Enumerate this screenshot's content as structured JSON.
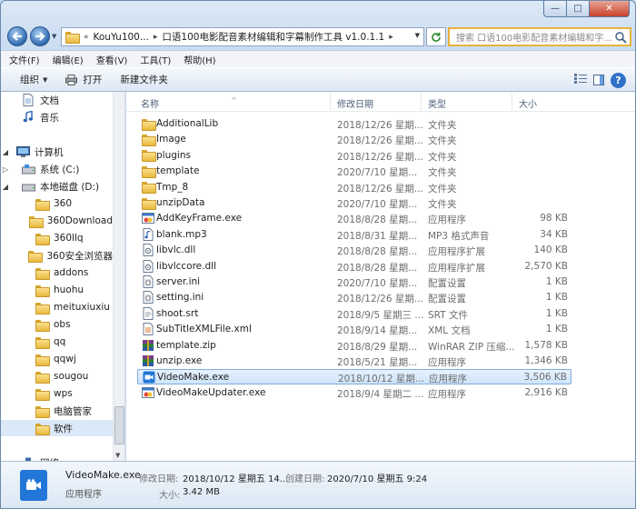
{
  "window": {
    "caption_minimize": "—",
    "caption_maximize": "□",
    "caption_close": "✕"
  },
  "address_bar": {
    "crumbs": [
      "«",
      "KouYu100...",
      "口语100电影配音素材编辑和字幕制作工具 v1.0.1.1"
    ],
    "search_placeholder": "搜索 口语100电影配音素材编辑和字..."
  },
  "menu": [
    "文件(F)",
    "编辑(E)",
    "查看(V)",
    "工具(T)",
    "帮助(H)"
  ],
  "toolbar": {
    "organize": "组织",
    "print": "打开",
    "new_folder": "新建文件夹"
  },
  "nav_pane": {
    "items": [
      {
        "label": "文档",
        "icon": "document-icon"
      },
      {
        "label": "音乐",
        "icon": "music-icon"
      },
      {
        "label": "计算机",
        "icon": "computer-icon"
      },
      {
        "label": "系统 (C:)",
        "icon": "drive-icon"
      },
      {
        "label": "本地磁盘 (D:)",
        "icon": "drive-icon"
      },
      {
        "label": "360",
        "icon": "folder-icon"
      },
      {
        "label": "360Download",
        "icon": "folder-icon"
      },
      {
        "label": "360llq",
        "icon": "folder-icon"
      },
      {
        "label": "360安全浏览器",
        "icon": "folder-icon"
      },
      {
        "label": "addons",
        "icon": "folder-icon"
      },
      {
        "label": "huohu",
        "icon": "folder-icon"
      },
      {
        "label": "meituxiuxiu",
        "icon": "folder-icon"
      },
      {
        "label": "obs",
        "icon": "folder-icon"
      },
      {
        "label": "qq",
        "icon": "folder-icon"
      },
      {
        "label": "qqwj",
        "icon": "folder-icon"
      },
      {
        "label": "sougou",
        "icon": "folder-icon"
      },
      {
        "label": "wps",
        "icon": "folder-icon"
      },
      {
        "label": "电脑管家",
        "icon": "folder-icon"
      },
      {
        "label": "软件",
        "icon": "folder-icon"
      },
      {
        "label": "网络",
        "icon": "network-icon"
      }
    ]
  },
  "columns": {
    "name": "名称",
    "date": "修改日期",
    "type": "类型",
    "size": "大小"
  },
  "files": [
    {
      "name": "AdditionalLib",
      "date": "2018/12/26 星期...",
      "type": "文件夹",
      "size": "",
      "icon": "folder-icon"
    },
    {
      "name": "Image",
      "date": "2018/12/26 星期...",
      "type": "文件夹",
      "size": "",
      "icon": "folder-icon"
    },
    {
      "name": "plugins",
      "date": "2018/12/26 星期...",
      "type": "文件夹",
      "size": "",
      "icon": "folder-icon"
    },
    {
      "name": "template",
      "date": "2020/7/10 星期...",
      "type": "文件夹",
      "size": "",
      "icon": "folder-icon"
    },
    {
      "name": "Tmp_8",
      "date": "2018/12/26 星期...",
      "type": "文件夹",
      "size": "",
      "icon": "folder-icon"
    },
    {
      "name": "unzipData",
      "date": "2020/7/10 星期...",
      "type": "文件夹",
      "size": "",
      "icon": "folder-icon"
    },
    {
      "name": "AddKeyFrame.exe",
      "date": "2018/8/28 星期...",
      "type": "应用程序",
      "size": "98 KB",
      "icon": "exe-icon"
    },
    {
      "name": "blank.mp3",
      "date": "2018/8/31 星期...",
      "type": "MP3 格式声音",
      "size": "34 KB",
      "icon": "audio-file-icon"
    },
    {
      "name": "libvlc.dll",
      "date": "2018/8/28 星期...",
      "type": "应用程序扩展",
      "size": "140 KB",
      "icon": "dll-icon"
    },
    {
      "name": "libvlccore.dll",
      "date": "2018/8/28 星期...",
      "type": "应用程序扩展",
      "size": "2,570 KB",
      "icon": "dll-icon"
    },
    {
      "name": "server.ini",
      "date": "2020/7/10 星期...",
      "type": "配置设置",
      "size": "1 KB",
      "icon": "ini-icon"
    },
    {
      "name": "setting.ini",
      "date": "2018/12/26 星期...",
      "type": "配置设置",
      "size": "1 KB",
      "icon": "ini-icon"
    },
    {
      "name": "shoot.srt",
      "date": "2018/9/5 星期三 ...",
      "type": "SRT 文件",
      "size": "1 KB",
      "icon": "text-file-icon"
    },
    {
      "name": "SubTitleXMLFile.xml",
      "date": "2018/9/14 星期...",
      "type": "XML 文档",
      "size": "1 KB",
      "icon": "xml-icon"
    },
    {
      "name": "template.zip",
      "date": "2018/8/29 星期...",
      "type": "WinRAR ZIP 压缩...",
      "size": "1,578 KB",
      "icon": "winrar-icon"
    },
    {
      "name": "unzip.exe",
      "date": "2018/5/21 星期...",
      "type": "应用程序",
      "size": "1,346 KB",
      "icon": "winrar-icon"
    },
    {
      "name": "VideoMake.exe",
      "date": "2018/10/12 星期...",
      "type": "应用程序",
      "size": "3,506 KB",
      "icon": "video-app-icon"
    },
    {
      "name": "VideoMakeUpdater.exe",
      "date": "2018/9/4 星期二 ...",
      "type": "应用程序",
      "size": "2,916 KB",
      "icon": "exe-icon"
    }
  ],
  "selected_file": "VideoMake.exe",
  "details": {
    "name": "VideoMake.exe",
    "type": "应用程序",
    "modified_label": "修改日期:",
    "modified_value": "2018/10/12 星期五 14...",
    "created_label": "创建日期:",
    "created_value": "2020/7/10 星期五 9:24",
    "size_label": "大小:",
    "size_value": "3.42 MB"
  },
  "colors": {
    "accent": "#2176d8",
    "selection_bg": "#cfe4fa",
    "selection_border": "#84acdd",
    "search_border": "#e8b23a",
    "window_frame": "#c8dbf0"
  }
}
